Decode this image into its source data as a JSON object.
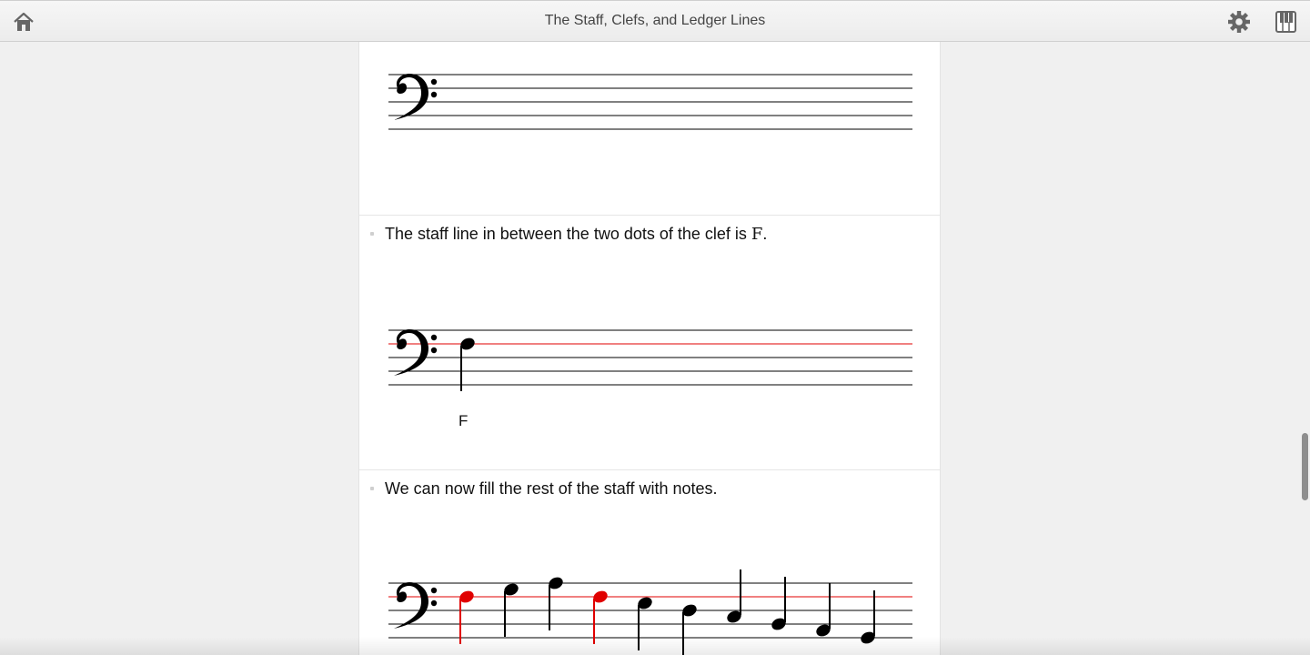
{
  "window": {
    "title": "The Staff, Clefs, and Ledger Lines"
  },
  "toolbar": {
    "home_icon": "home-icon",
    "settings_icon": "gear-icon",
    "keyboard_icon": "piano-keyboard-icon"
  },
  "sections": [
    {
      "caption": "",
      "clef": "bass-clef",
      "notes": []
    },
    {
      "caption_prefix": "The staff line in between the two dots of the clef is ",
      "caption_note": "F",
      "caption_suffix": ".",
      "clef": "bass-clef",
      "highlighted_line": "F",
      "notes": [
        {
          "pitch": "F",
          "label": "F",
          "color": "#000000"
        }
      ],
      "note_label": "F"
    },
    {
      "caption": "We can now fill the rest of the staff with notes.",
      "clef": "bass-clef",
      "highlighted_line": "F",
      "notes": [
        {
          "pitch": "F",
          "color": "#e00000"
        },
        {
          "pitch": "G",
          "color": "#000000"
        },
        {
          "pitch": "A",
          "color": "#000000"
        },
        {
          "pitch": "F",
          "color": "#e00000"
        },
        {
          "pitch": "E",
          "color": "#000000"
        },
        {
          "pitch": "D",
          "color": "#000000"
        },
        {
          "pitch": "C",
          "color": "#000000"
        },
        {
          "pitch": "B",
          "color": "#000000"
        },
        {
          "pitch": "A",
          "color": "#000000"
        },
        {
          "pitch": "G",
          "color": "#000000"
        }
      ]
    }
  ],
  "colors": {
    "highlight": "#e00000",
    "staff_line": "#000000"
  }
}
